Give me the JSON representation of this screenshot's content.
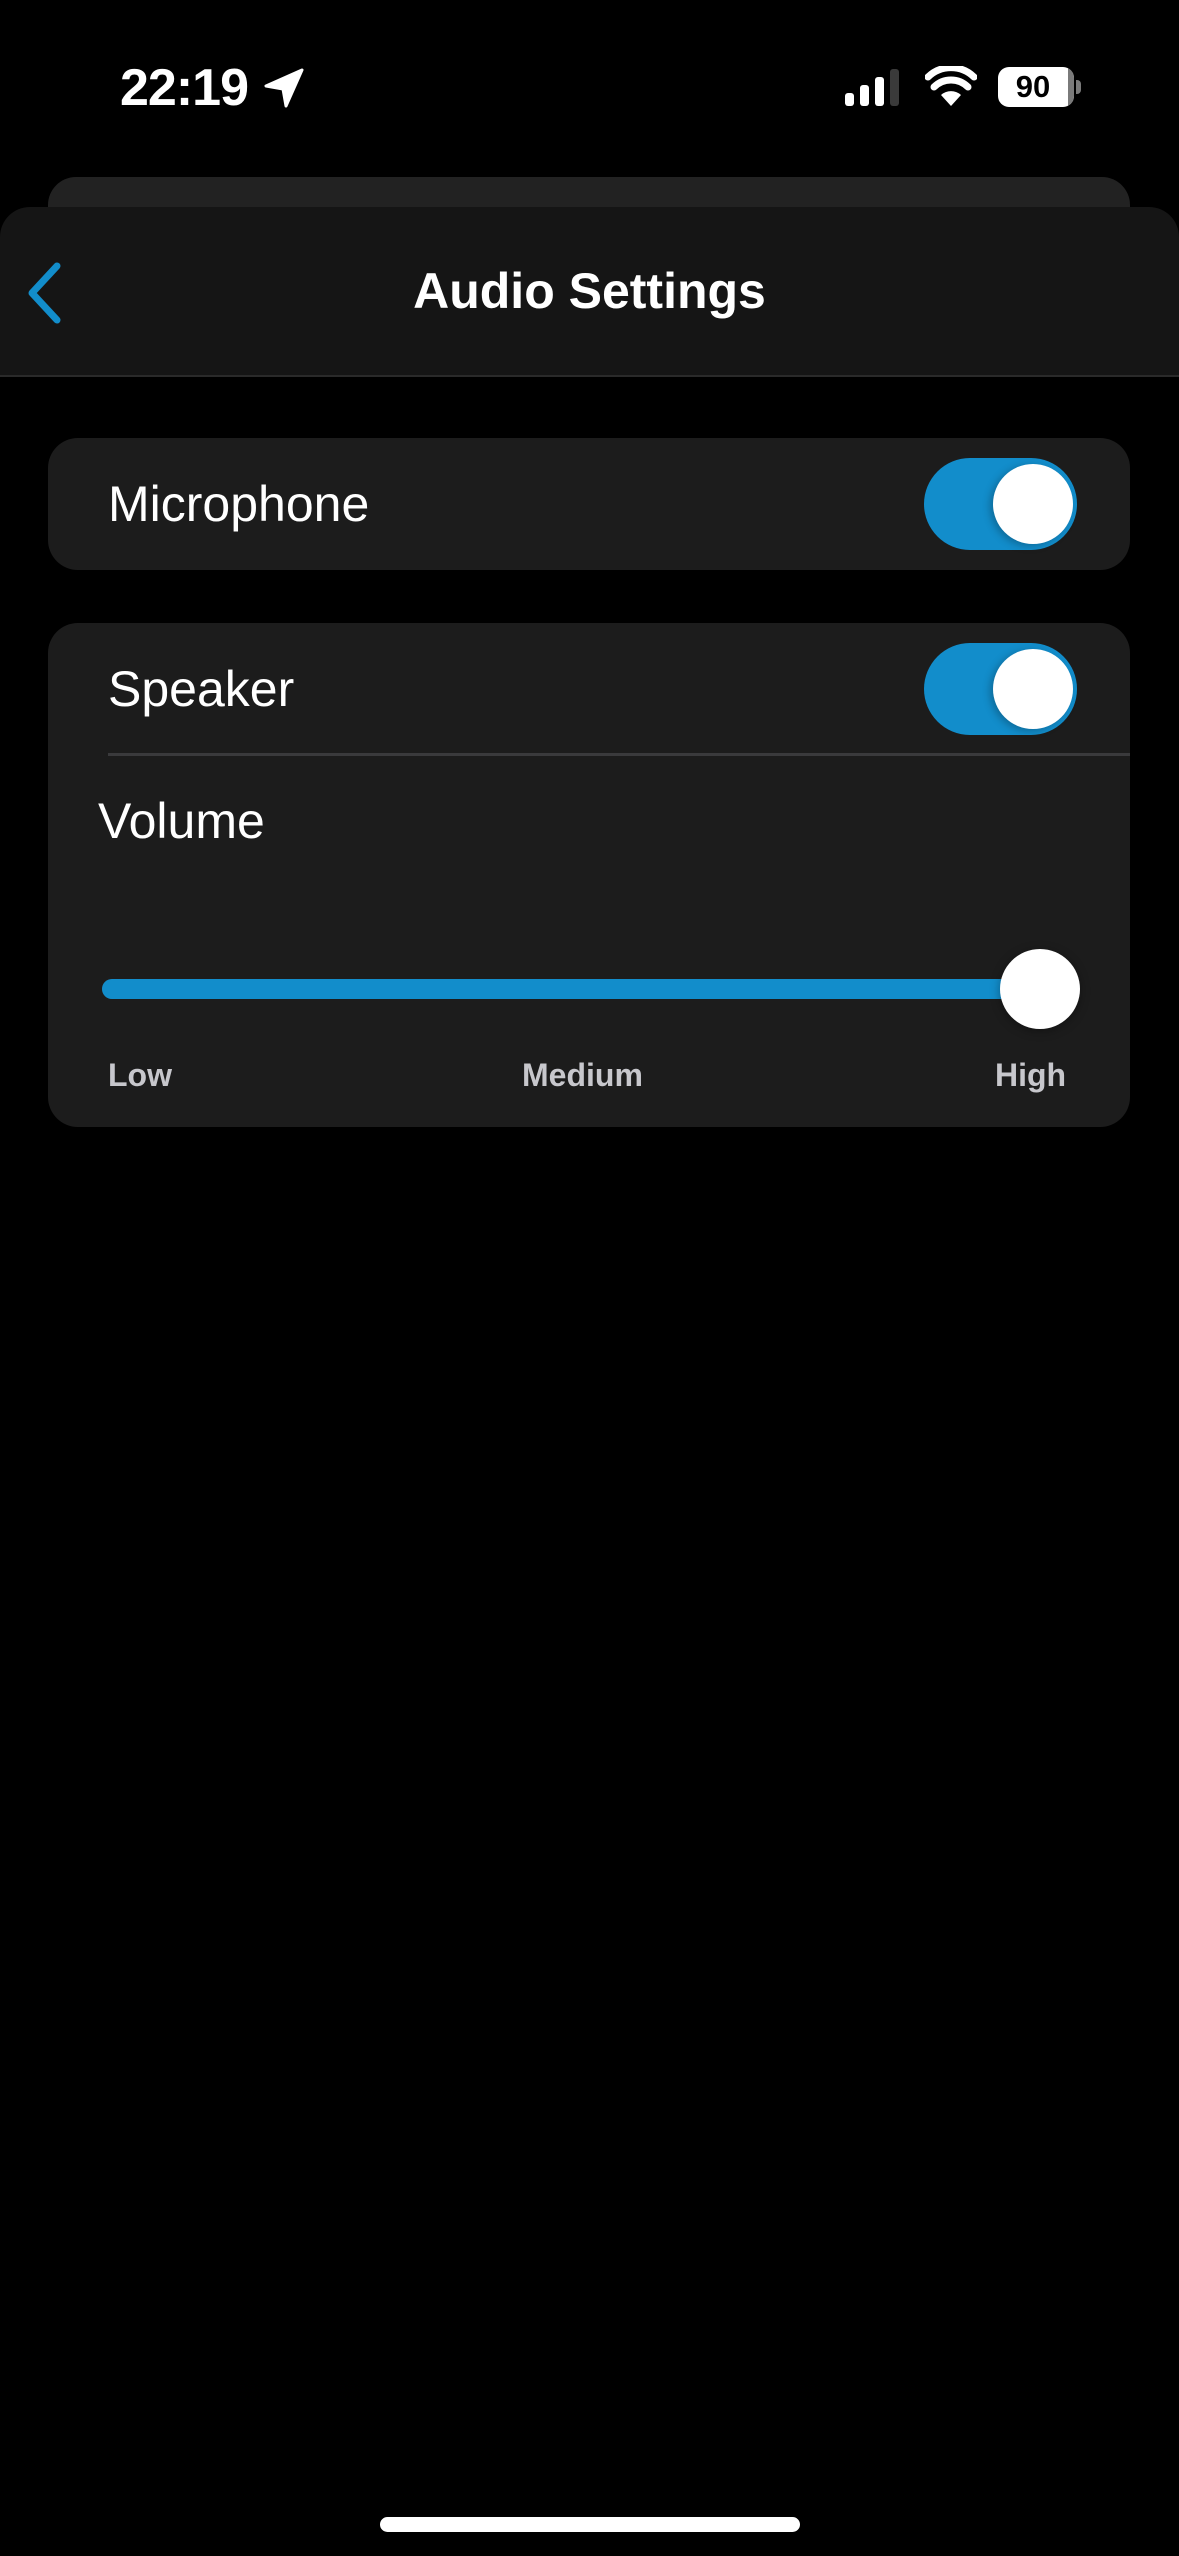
{
  "status_bar": {
    "time": "22:19",
    "location_icon": "location-arrow-icon",
    "signal_icon": "cellular-signal-icon",
    "signal_bars_active": 3,
    "signal_bars_total": 4,
    "wifi_icon": "wifi-icon",
    "battery_percent": "90"
  },
  "header": {
    "back_icon": "chevron-left-icon",
    "title": "Audio Settings"
  },
  "settings": {
    "microphone": {
      "label": "Microphone",
      "enabled": true
    },
    "speaker": {
      "label": "Speaker",
      "enabled": true
    },
    "volume": {
      "label": "Volume",
      "value_fraction": 1.0,
      "ticks": [
        "Low",
        "Medium",
        "High"
      ]
    }
  },
  "colors": {
    "accent": "#128dcb",
    "background": "#000000",
    "card": "#1c1c1c",
    "header": "#151515",
    "tick_text": "#c7c7cc"
  }
}
